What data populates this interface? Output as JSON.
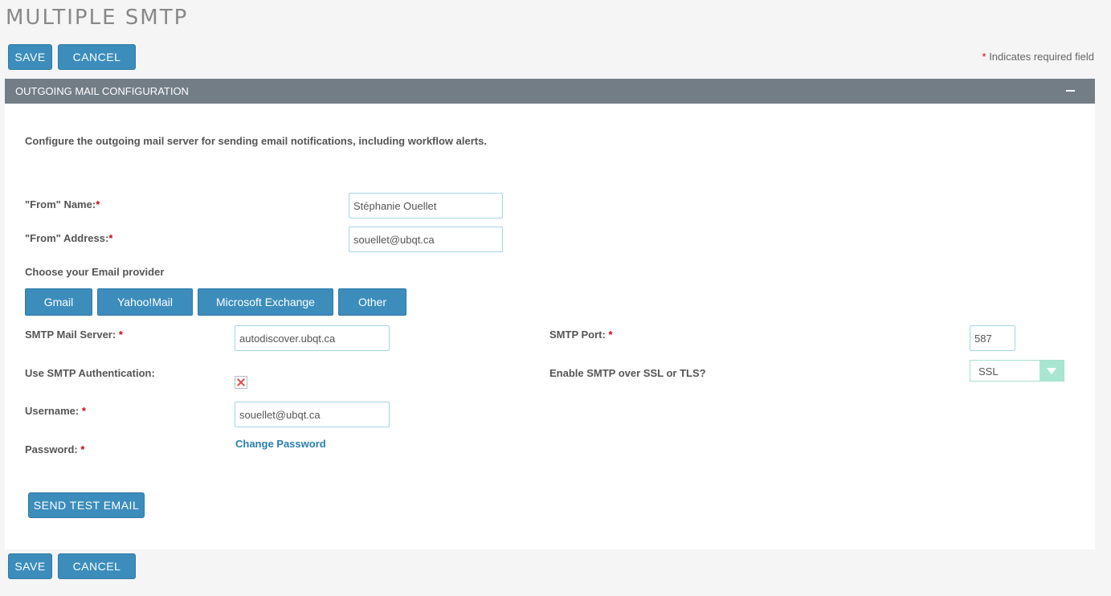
{
  "page": {
    "title": "MULTIPLE SMTP"
  },
  "toolbar": {
    "save_label": "SAVE",
    "cancel_label": "CANCEL",
    "required_star": "*",
    "required_text": "Indicates required field"
  },
  "panel": {
    "header": "OUTGOING MAIL CONFIGURATION",
    "description": "Configure the outgoing mail server for sending email notifications, including workflow alerts.",
    "from_name": {
      "label": "\"From\" Name:",
      "required": "*",
      "value": "Stéphanie Ouellet"
    },
    "from_address": {
      "label": "\"From\" Address:",
      "required": "*",
      "value": "souellet@ubqt.ca"
    },
    "provider": {
      "label": "Choose your Email provider",
      "options": [
        "Gmail",
        "Yahoo!Mail",
        "Microsoft Exchange",
        "Other"
      ]
    },
    "smtp_server": {
      "label": "SMTP Mail Server:",
      "required": "*",
      "value": "autodiscover.ubqt.ca"
    },
    "smtp_port": {
      "label": "SMTP Port:",
      "required": "*",
      "value": "587"
    },
    "smtp_auth": {
      "label": "Use SMTP Authentication:"
    },
    "ssl": {
      "label": "Enable SMTP over SSL or TLS?",
      "value": "SSL"
    },
    "username": {
      "label": "Username:",
      "required": "*",
      "value": "souellet@ubqt.ca"
    },
    "password": {
      "label": "Password:",
      "required": "*",
      "link": "Change Password"
    },
    "send_test_label": "SEND TEST EMAIL"
  },
  "colors": {
    "primary": "#3c8dbc",
    "header_bg": "#737d86",
    "required": "#d0021b"
  }
}
